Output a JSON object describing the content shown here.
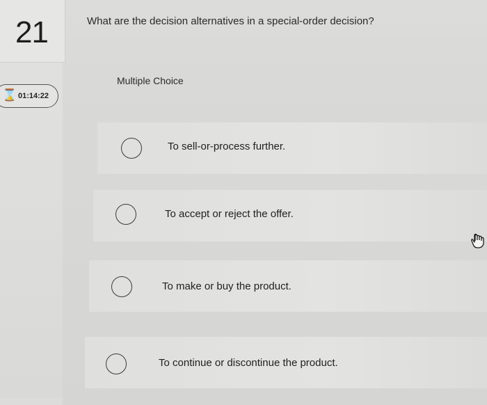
{
  "question": {
    "number": "21",
    "text": "What are the decision alternatives in a special-order decision?",
    "type_label": "Multiple Choice"
  },
  "timer": {
    "icon": "hourglass-icon",
    "value": "01:14:22"
  },
  "choices": [
    {
      "label": "To sell-or-process further."
    },
    {
      "label": "To accept or reject the offer."
    },
    {
      "label": "To make or buy the product."
    },
    {
      "label": "To continue or discontinue the product."
    }
  ],
  "cursor": {
    "icon": "hand-pointer-icon"
  }
}
